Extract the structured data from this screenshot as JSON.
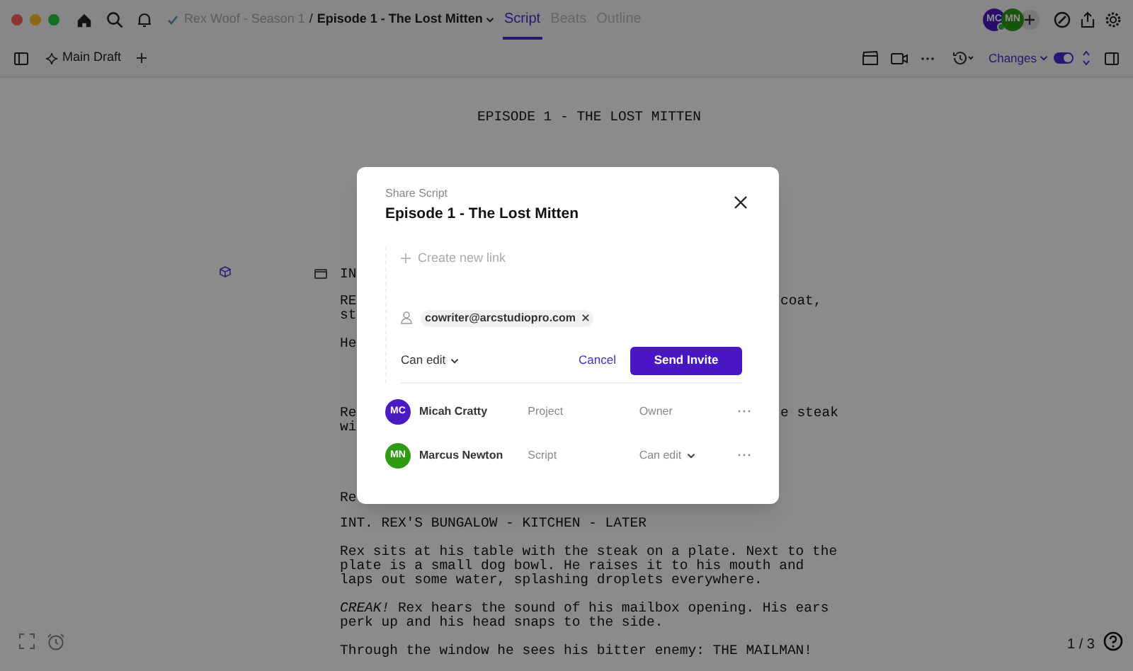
{
  "topbar": {
    "breadcrumb": {
      "project": "Rex Woof - Season 1",
      "separator": "/",
      "episode": "Episode 1 - The Lost Mitten"
    },
    "tabs": [
      {
        "label": "Script",
        "selected": true
      },
      {
        "label": "Beats",
        "selected": false
      },
      {
        "label": "Outline",
        "selected": false
      }
    ],
    "avatars": [
      {
        "initials": "MC",
        "online": true
      },
      {
        "initials": "MN",
        "online": false
      }
    ]
  },
  "toolbar": {
    "draft": "Main Draft",
    "changes": {
      "label": "Changes",
      "on": true
    }
  },
  "script": {
    "title": "EPISODE 1 - THE LOST MITTEN",
    "covered_lines": [
      {
        "left": "IN"
      },
      {
        "left": "RE",
        "right": "coat,"
      },
      {
        "left": "st"
      },
      {
        "left": "He"
      },
      {
        "left": "Re",
        "right": "e steak"
      },
      {
        "left": "wi"
      },
      {
        "left": "Re"
      }
    ],
    "paragraphs": [
      {
        "kind": "scene",
        "text": "INT. REX'S BUNGALOW - KITCHEN - LATER"
      },
      {
        "kind": "action",
        "text": "Rex sits at his table with the steak on a plate. Next to the plate is a small dog bowl. He raises it to his mouth and laps out some water, splashing droplets everywhere."
      },
      {
        "kind": "action",
        "text": "*CREAK!* Rex hears the sound of his mailbox opening. His ears perk up and his head snaps to the side."
      },
      {
        "kind": "action",
        "text": "Through the window he sees his bitter enemy: THE MAILMAN!"
      }
    ]
  },
  "footer": {
    "page": "1 / 3"
  },
  "modal": {
    "header": "Share Script",
    "title": "Episode 1 - The Lost Mitten",
    "create_link": "Create new link",
    "invite": {
      "email": "cowriter@arcstudiopro.com",
      "permission": "Can edit",
      "cancel": "Cancel",
      "send": "Send Invite"
    },
    "members": [
      {
        "initials": "MC",
        "color": "#4a1bc2",
        "name": "Micah Cratty",
        "scope": "Project",
        "role": "Owner",
        "editable": false
      },
      {
        "initials": "MN",
        "color": "#2f9a14",
        "name": "Marcus Newton",
        "scope": "Script",
        "role": "Can edit",
        "editable": true
      }
    ]
  }
}
